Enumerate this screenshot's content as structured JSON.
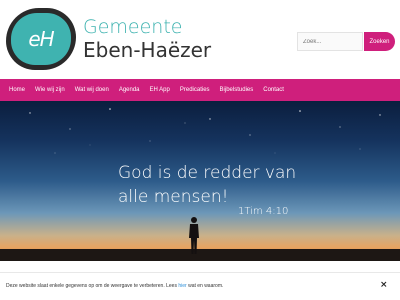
{
  "header": {
    "logo_text": "eH",
    "site_name_line1": "Gemeente",
    "site_name_line2": "Eben-Haëzer"
  },
  "search": {
    "placeholder": "Zoek...",
    "button_label": "Zoeken"
  },
  "nav": {
    "items": [
      {
        "label": "Home"
      },
      {
        "label": "Wie wij zijn"
      },
      {
        "label": "Wat wij doen"
      },
      {
        "label": "Agenda"
      },
      {
        "label": "EH App"
      },
      {
        "label": "Predicaties"
      },
      {
        "label": "Bijbelstudies"
      },
      {
        "label": "Contact"
      }
    ]
  },
  "hero": {
    "line1": "God is de redder van",
    "line2": "alle mensen!",
    "reference": "1Tim 4:10"
  },
  "cookie": {
    "text_before": "Deze website slaat enkele gegevens op om de weergave te verbeteren. Lees ",
    "link_label": "hier",
    "text_after": " wat en waarom.",
    "close_label": "×"
  },
  "colors": {
    "accent": "#cf1f7c",
    "teal": "#3fb3b0"
  }
}
